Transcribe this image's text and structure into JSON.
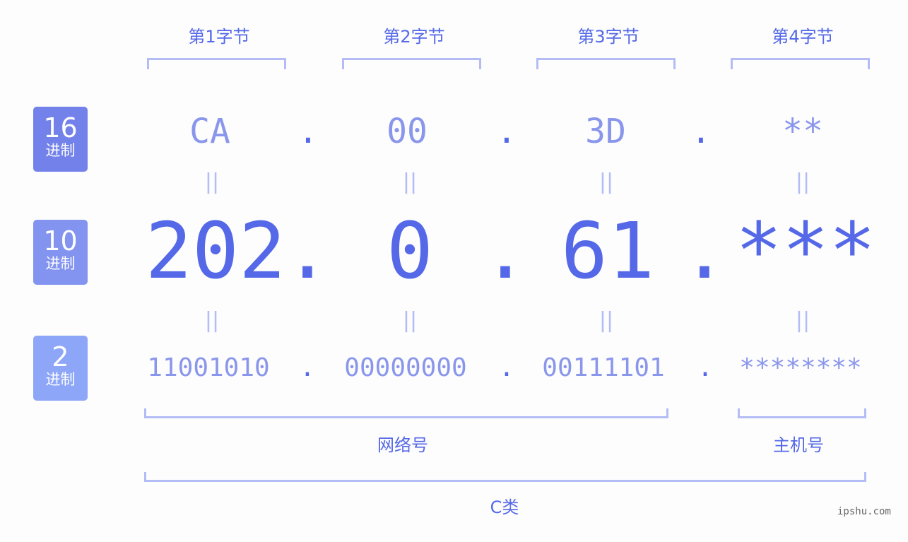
{
  "byte_headers": [
    "第1字节",
    "第2字节",
    "第3字节",
    "第4字节"
  ],
  "rows": {
    "hex": {
      "badge_num": "16",
      "badge_sub": "进制",
      "badge_color": "#7382ea",
      "values": [
        "CA",
        "00",
        "3D",
        "**"
      ]
    },
    "dec": {
      "badge_num": "10",
      "badge_sub": "进制",
      "badge_color": "#8394f0",
      "values": [
        "202",
        "0",
        "61",
        "***"
      ]
    },
    "bin": {
      "badge_num": "2",
      "badge_sub": "进制",
      "badge_color": "#8da6f8",
      "values": [
        "11001010",
        "00000000",
        "00111101",
        "********"
      ]
    }
  },
  "separator": ".",
  "equals": "||",
  "network_label": "网络号",
  "host_label": "主机号",
  "class_label": "C类",
  "watermark": "ipshu.com",
  "colors": {
    "accent": "#5568e8",
    "light": "#8a96ec",
    "bracket": "#b4bcf6"
  }
}
